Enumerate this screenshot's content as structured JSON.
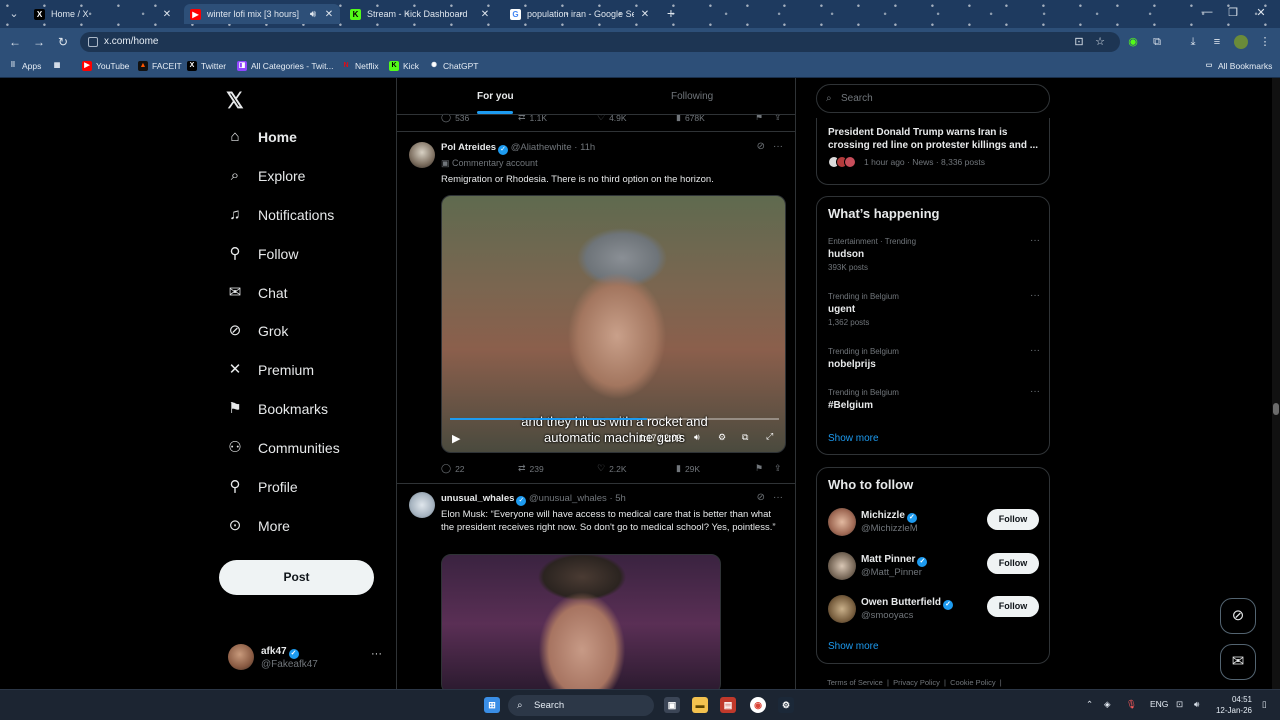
{
  "browser": {
    "tabs": [
      {
        "title": "Home / X",
        "favicon": "x-favicon",
        "favicon_color": "#000000",
        "active": false
      },
      {
        "title": "winter lofi mix [3 hours] ❄️",
        "favicon": "youtube-favicon",
        "favicon_color": "#ff0000",
        "active": true
      },
      {
        "title": "Stream - Kick Dashboard",
        "favicon": "kick-favicon",
        "favicon_color": "#53fc18",
        "active": false
      },
      {
        "title": "population iran - Google Search",
        "favicon": "google-favicon",
        "favicon_color": "#4285f4",
        "active": false
      }
    ],
    "url": "x.com/home",
    "bookmarks": [
      {
        "label": "Apps",
        "icon": "apps-grid-icon"
      },
      {
        "label": "",
        "icon": "grid-icon"
      },
      {
        "label": "YouTube",
        "icon": "youtube-icon",
        "color": "#ff0000"
      },
      {
        "label": "FACEIT",
        "icon": "faceit-icon",
        "color": "#ff5500"
      },
      {
        "label": "Twitter",
        "icon": "x-icon",
        "color": "#000000"
      },
      {
        "label": "All Categories - Twit...",
        "icon": "twitch-icon",
        "color": "#9146ff"
      },
      {
        "label": "Netflix",
        "icon": "netflix-icon",
        "color": "#e50914"
      },
      {
        "label": "Kick",
        "icon": "kick-icon",
        "color": "#53fc18"
      },
      {
        "label": "ChatGPT",
        "icon": "chatgpt-icon",
        "color": "#ffffff"
      }
    ],
    "all_bookmarks": "All Bookmarks"
  },
  "nav": {
    "items": [
      {
        "label": "Home",
        "icon": "home-icon",
        "glyph": "⌂"
      },
      {
        "label": "Explore",
        "icon": "search-icon",
        "glyph": "⌕"
      },
      {
        "label": "Notifications",
        "icon": "bell-icon",
        "glyph": "🔔︎"
      },
      {
        "label": "Follow",
        "icon": "person-plus-icon",
        "glyph": "⚲"
      },
      {
        "label": "Chat",
        "icon": "mail-icon",
        "glyph": "✉"
      },
      {
        "label": "Grok",
        "icon": "grok-icon",
        "glyph": "⊘"
      },
      {
        "label": "Premium",
        "icon": "x-icon",
        "glyph": "𝕏"
      },
      {
        "label": "Bookmarks",
        "icon": "bookmark-icon",
        "glyph": "⚑"
      },
      {
        "label": "Communities",
        "icon": "people-icon",
        "glyph": "⚇"
      },
      {
        "label": "Profile",
        "icon": "person-icon",
        "glyph": "⚲"
      },
      {
        "label": "More",
        "icon": "more-circle-icon",
        "glyph": "⋯"
      }
    ],
    "post_button": "Post",
    "account": {
      "name": "afk47",
      "handle": "@Fakeafk47"
    }
  },
  "feed": {
    "tabs": [
      "For you",
      "Following"
    ],
    "prev_stats": {
      "replies": "536",
      "reposts": "1.1K",
      "likes": "4.9K",
      "views": "678K"
    },
    "posts": [
      {
        "name": "Pol Atreides",
        "handle": "@Aliathewhite",
        "time": "11h",
        "label": "Commentary account",
        "text": "Remigration or Rhodesia. There is no third option on the horizon.",
        "video": {
          "subtitle_line1": "and they hit us with a rocket and",
          "subtitle_line2": "automatic machine guns",
          "time": "1:17 / 2:09",
          "progress": 0.6
        },
        "stats": {
          "replies": "22",
          "reposts": "239",
          "likes": "2.2K",
          "views": "29K"
        }
      },
      {
        "name": "unusual_whales",
        "handle": "@unusual_whales",
        "time": "5h",
        "text": "Elon Musk: “Everyone will have access to medical care that is better than what the president receives right now. So don't go to medical school? Yes, pointless.”"
      }
    ]
  },
  "sidebar": {
    "search_placeholder": "Search",
    "news": {
      "title": "President Donald Trump warns Iran is crossing red line on protester killings and ...",
      "meta": "1 hour ago · News · 8,336 posts"
    },
    "whats_happening": {
      "title": "What’s happening",
      "trends": [
        {
          "category": "Entertainment · Trending",
          "name": "hudson",
          "count": "393K posts"
        },
        {
          "category": "Trending in Belgium",
          "name": "ugent",
          "count": "1,362 posts"
        },
        {
          "category": "Trending in Belgium",
          "name": "nobelprijs",
          "count": ""
        },
        {
          "category": "Trending in Belgium",
          "name": "#Belgium",
          "count": ""
        }
      ],
      "show_more": "Show more"
    },
    "who_to_follow": {
      "title": "Who to follow",
      "accounts": [
        {
          "name": "Michizzle",
          "handle": "@MichizzleM",
          "button": "Follow"
        },
        {
          "name": "Matt Pinner",
          "handle": "@Matt_Pinner",
          "button": "Follow"
        },
        {
          "name": "Owen Butterfield",
          "handle": "@smooyacs",
          "button": "Follow"
        }
      ],
      "show_more": "Show more"
    },
    "footer": [
      "Terms of Service",
      "Privacy Policy",
      "Cookie Policy"
    ]
  },
  "taskbar": {
    "search": "Search",
    "lang": "ENG",
    "time": "04:51",
    "date": "12-Jan-26"
  }
}
